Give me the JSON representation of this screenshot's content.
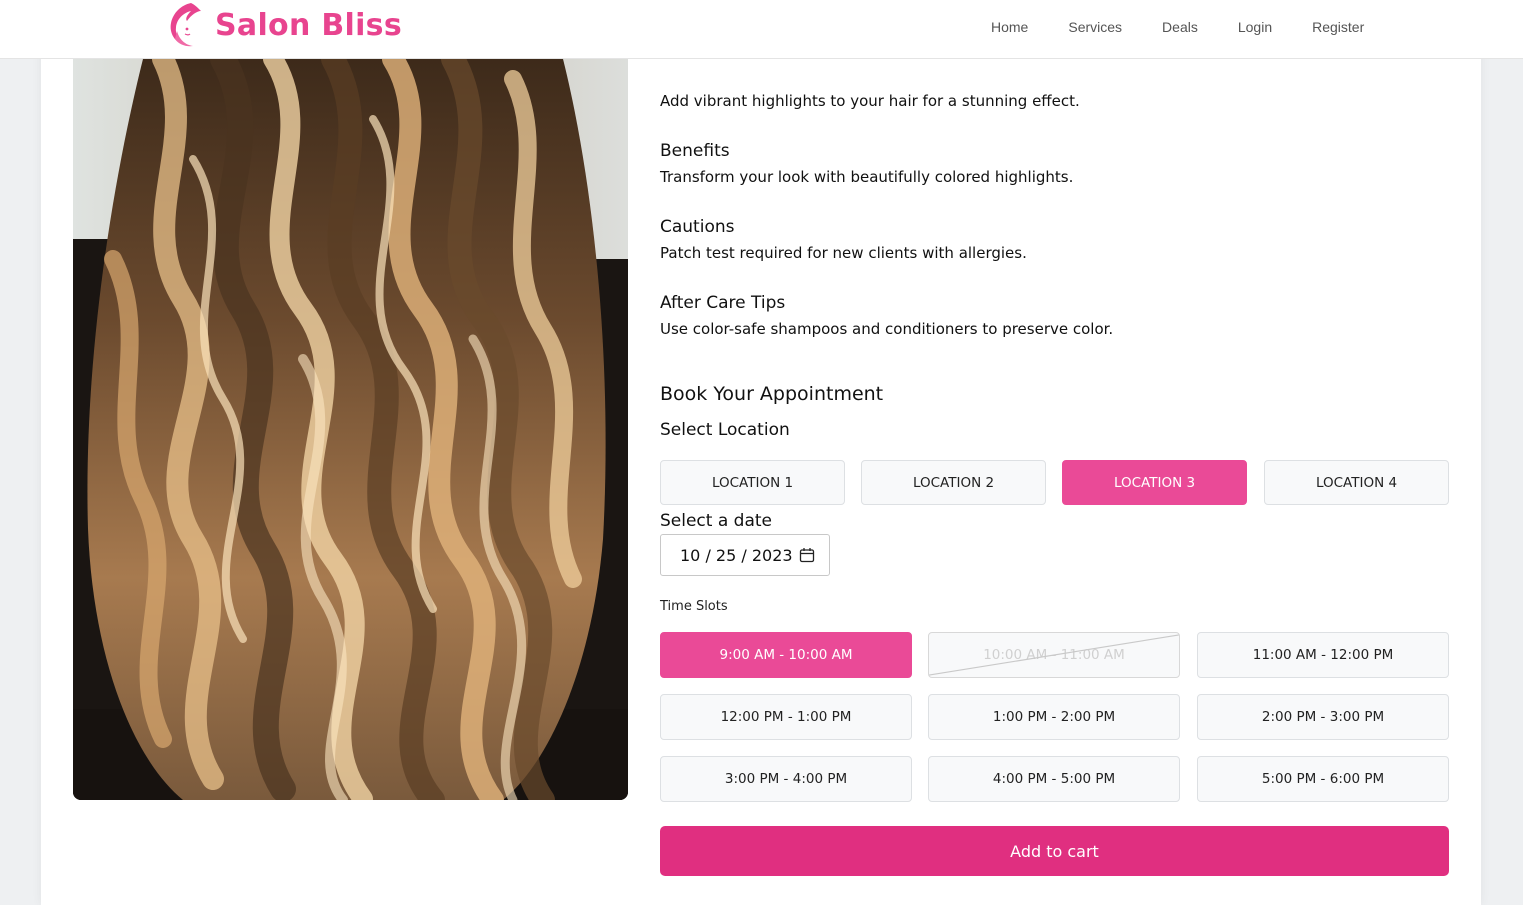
{
  "brand": {
    "name": "Salon Bliss",
    "color": "#e8448f"
  },
  "nav": {
    "links": [
      "Home",
      "Services",
      "Deals",
      "Login",
      "Register"
    ]
  },
  "service": {
    "description": "Add vibrant highlights to your hair for a stunning effect.",
    "sections": [
      {
        "title": "Benefits",
        "text": "Transform your look with beautifully colored highlights."
      },
      {
        "title": "Cautions",
        "text": "Patch test required for new clients with allergies."
      },
      {
        "title": "After Care Tips",
        "text": "Use color-safe shampoos and conditioners to preserve color."
      }
    ]
  },
  "booking": {
    "title": "Book Your Appointment",
    "location_label": "Select Location",
    "locations": [
      "LOCATION 1",
      "LOCATION 2",
      "LOCATION 3",
      "LOCATION 4"
    ],
    "selected_location": "LOCATION 3",
    "date_label": "Select a date",
    "date_value": "10 / 25 / 2023",
    "slots_label": "Time Slots",
    "slots": [
      {
        "label": "9:00 AM - 10:00 AM",
        "state": "selected"
      },
      {
        "label": "10:00 AM - 11:00 AM",
        "state": "unavailable"
      },
      {
        "label": "11:00 AM - 12:00 PM",
        "state": "available"
      },
      {
        "label": "12:00 PM - 1:00 PM",
        "state": "available"
      },
      {
        "label": "1:00 PM - 2:00 PM",
        "state": "available"
      },
      {
        "label": "2:00 PM - 3:00 PM",
        "state": "available"
      },
      {
        "label": "3:00 PM - 4:00 PM",
        "state": "available"
      },
      {
        "label": "4:00 PM - 5:00 PM",
        "state": "available"
      },
      {
        "label": "5:00 PM - 6:00 PM",
        "state": "available"
      }
    ],
    "cart_label": "Add to cart",
    "accent_color": "#ea4a97",
    "cart_color": "#e02f80"
  }
}
